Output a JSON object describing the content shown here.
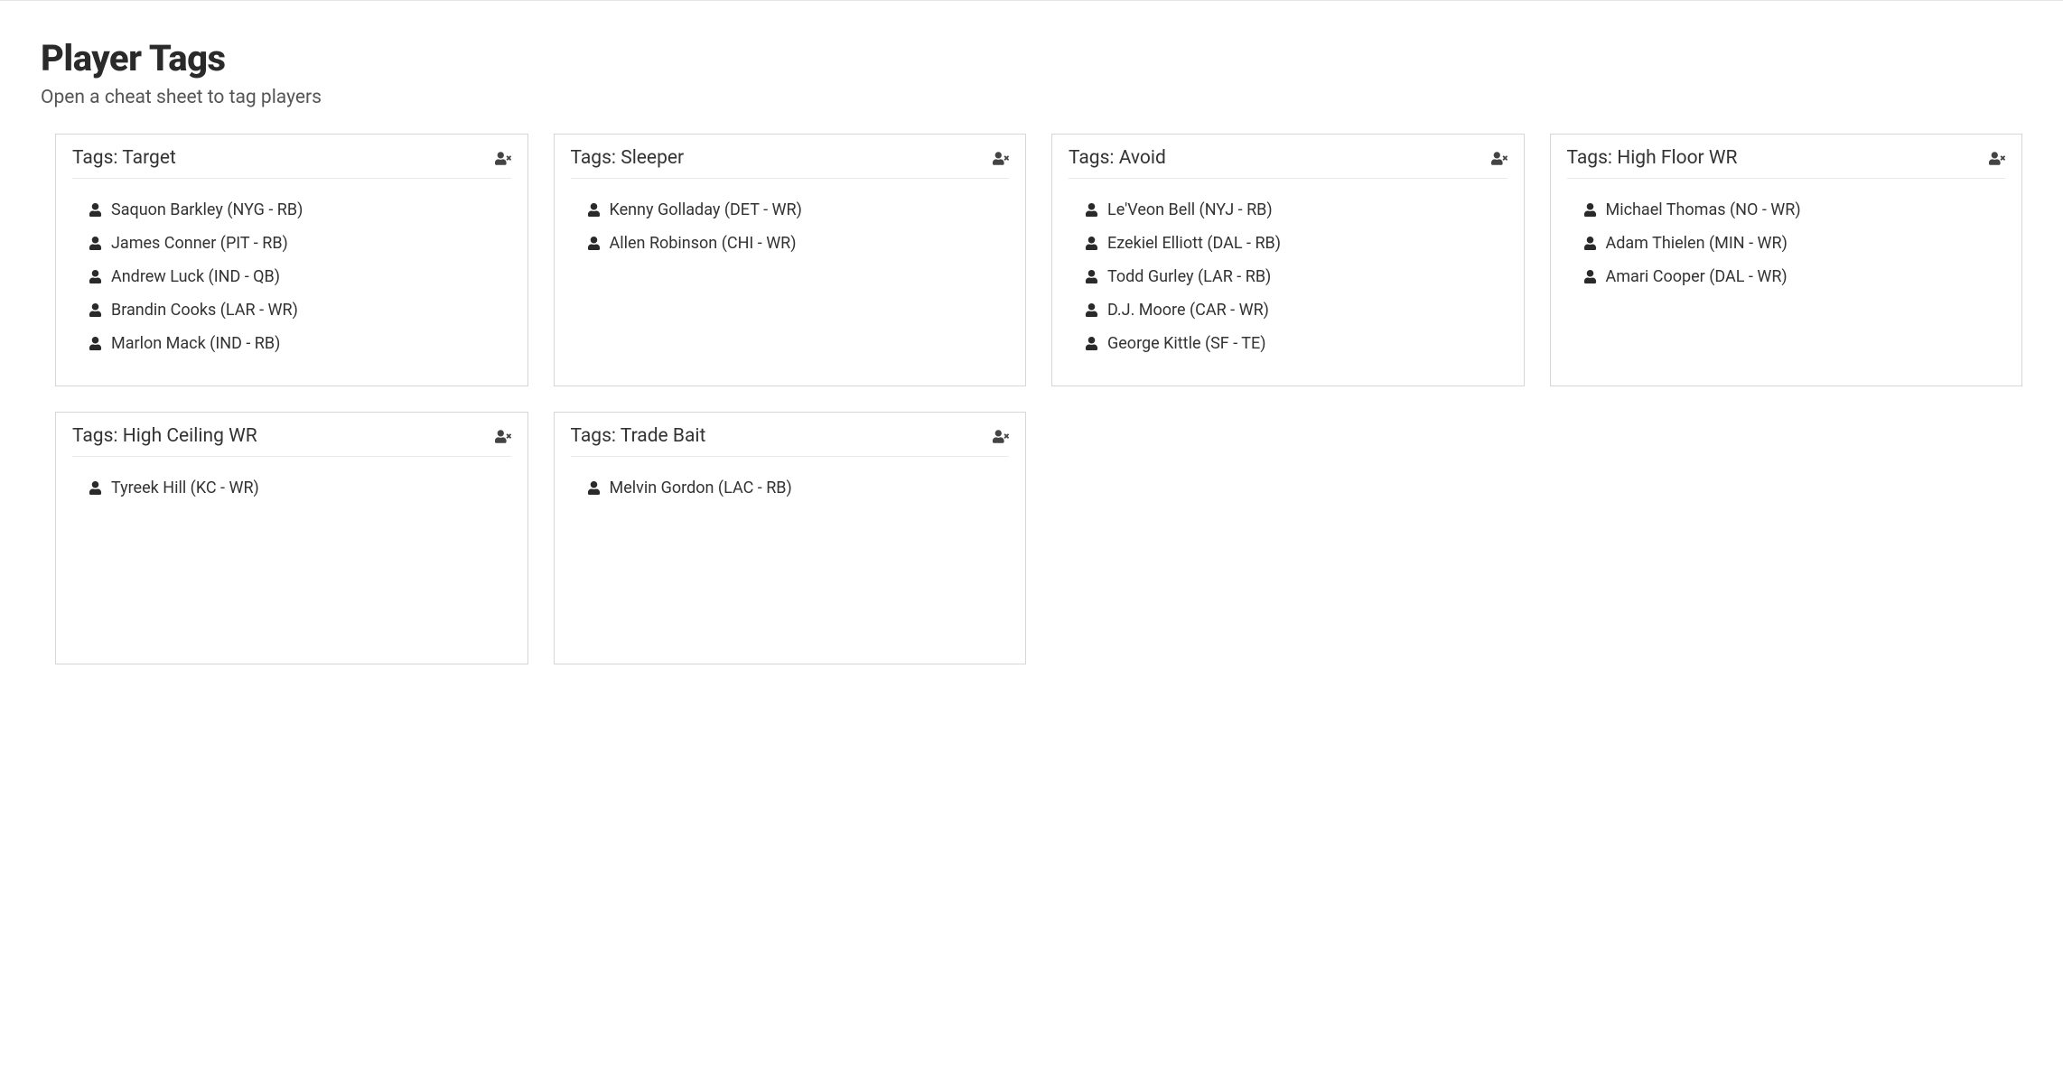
{
  "header": {
    "title": "Player Tags",
    "subtitle": "Open a cheat sheet to tag players"
  },
  "tag_prefix": "Tags: ",
  "cards": [
    {
      "name": "Target",
      "players": [
        "Saquon Barkley (NYG - RB)",
        "James Conner (PIT - RB)",
        "Andrew Luck (IND - QB)",
        "Brandin Cooks (LAR - WR)",
        "Marlon Mack (IND - RB)"
      ]
    },
    {
      "name": "Sleeper",
      "players": [
        "Kenny Golladay (DET - WR)",
        "Allen Robinson (CHI - WR)"
      ]
    },
    {
      "name": "Avoid",
      "players": [
        "Le'Veon Bell (NYJ - RB)",
        "Ezekiel Elliott (DAL - RB)",
        "Todd Gurley (LAR - RB)",
        "D.J. Moore (CAR - WR)",
        "George Kittle (SF - TE)"
      ]
    },
    {
      "name": "High Floor WR",
      "players": [
        "Michael Thomas (NO - WR)",
        "Adam Thielen (MIN - WR)",
        "Amari Cooper (DAL - WR)"
      ]
    },
    {
      "name": "High Ceiling WR",
      "players": [
        "Tyreek Hill (KC - WR)"
      ]
    },
    {
      "name": "Trade Bait",
      "players": [
        "Melvin Gordon (LAC - RB)"
      ]
    }
  ]
}
